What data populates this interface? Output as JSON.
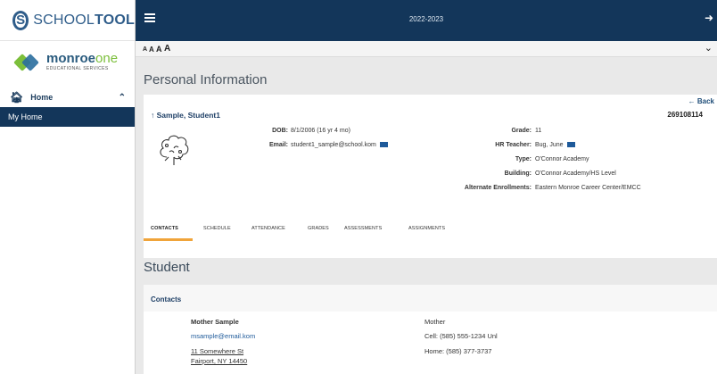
{
  "brand": {
    "logo_prefix": "SCHOOL",
    "logo_bold": "TOOL"
  },
  "partner": {
    "name_bold": "monroe",
    "name_light": "one",
    "tagline": "EDUCATIONAL SERVICES"
  },
  "sidebar": {
    "home_label": "Home",
    "items": [
      {
        "label": "My Home"
      }
    ]
  },
  "header": {
    "school_year": "2022-2023"
  },
  "font_sizes": [
    "A",
    "A",
    "A",
    "A"
  ],
  "page": {
    "title": "Personal Information",
    "back_label": "Back"
  },
  "student": {
    "name": "Sample, Student1",
    "id": "269108114",
    "dob_label": "DOB:",
    "dob": "8/1/2006 (16 yr 4 mo)",
    "email_label": "Email:",
    "email": "student1_sample@school.kom",
    "grade_label": "Grade:",
    "grade": "11",
    "hr_teacher_label": "HR Teacher:",
    "hr_teacher": "Bug, June",
    "type_label": "Type:",
    "type": "O'Connor Academy",
    "building_label": "Building:",
    "building": "O'Connor Academy/HS Level",
    "alt_enroll_label": "Alternate Enrollments:",
    "alt_enroll": "Eastern Monroe Career Center/EMCC"
  },
  "tabs": [
    {
      "label": "CONTACTS"
    },
    {
      "label": "SCHEDULE"
    },
    {
      "label": "ATTENDANCE"
    },
    {
      "label": "GRADES"
    },
    {
      "label": "ASSESSMENTS"
    },
    {
      "label": "ASSIGNMENTS"
    }
  ],
  "section": {
    "title": "Student",
    "contacts_heading": "Contacts"
  },
  "contact": {
    "name": "Mother Sample",
    "email": "msample@email.kom",
    "address_line1": "11 Somewhere St",
    "address_line2": "Fairport, NY 14450",
    "relationship": "Mother",
    "cell": "Cell: (585) 555-1234 Unl",
    "home": "Home: (585) 377-3737"
  }
}
